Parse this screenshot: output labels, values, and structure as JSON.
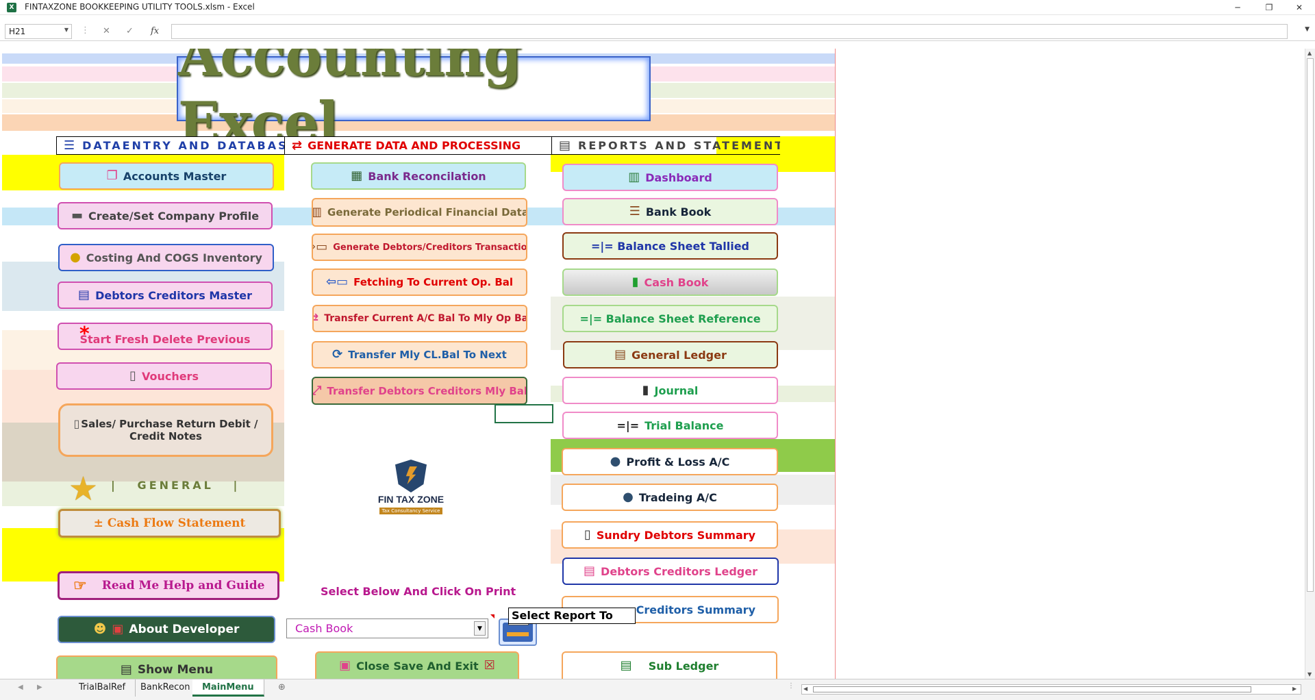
{
  "window": {
    "title": "FINTAXZONE BOOKKEEPING UTILITY TOOLS.xlsm - Excel",
    "app_icon": "excel-icon",
    "minimize": "─",
    "restore": "❐",
    "close": "✕"
  },
  "formula_bar": {
    "name_box": "H21",
    "cancel": "✕",
    "enter": "✓",
    "fx": "fx",
    "formula": ""
  },
  "banner": {
    "title": "Accounting Excel"
  },
  "sections": {
    "data_entry": "DATAENTRY AND DATABASE",
    "generate": "GENERATE DATA AND PROCESSING",
    "reports": "REPORTS AND STATEMENTS",
    "general": "|   GENERAL   |"
  },
  "left_buttons": {
    "accounts_master": "Accounts Master",
    "company_profile": "Create/Set Company Profile",
    "costing": "Costing And COGS Inventory",
    "debtors_creditors_master": "Debtors Creditors Master",
    "start_fresh": "Start Fresh Delete Previous",
    "vouchers": "Vouchers",
    "sales_purchase_line1": "Sales/ Purchase Return Debit /",
    "sales_purchase_line2": "Credit Notes",
    "cash_flow": "± Cash Flow Statement",
    "read_me": "Read Me Help and Guide",
    "about_developer": "About Developer",
    "show_menu": "Show Menu"
  },
  "mid_buttons": {
    "bank_reconcilation": "Bank Reconcilation",
    "periodical": "Generate Periodical Financial Data",
    "debtors_creditors_txn": "Generate Debtors/Creditors Transaction",
    "fetching": "Fetching  To Current Op. Bal",
    "transfer_current": "Transfer Current A/C Bal  To Mly Op Bal",
    "transfer_mly": "Transfer Mly  CL.Bal To Next",
    "transfer_debtors": "Transfer Debtors Creditors Mly Bal",
    "close_save": "Close Save And Exit"
  },
  "right_buttons": {
    "dashboard": "Dashboard",
    "bank_book": "Bank Book",
    "bs_tallied": "=|=   Balance Sheet Tallied",
    "cash_book": "Cash Book",
    "bs_reference": "=|=  Balance Sheet Reference",
    "general_ledger": "General Ledger",
    "journal": "Journal",
    "trial_balance_sym": "=|=",
    "trial_balance": "Trial Balance",
    "profit_loss": "Profit & Loss A/C",
    "trading": "Tradeing A/C",
    "sundry_debtors": "Sundry Debtors Summary",
    "debtors_creditors_ledger": "Debtors Creditors Ledger",
    "sundry_creditors": "ry Creditors Summary",
    "sub_ledger": "Sub Ledger"
  },
  "logo": {
    "name": "FIN TAX ZONE",
    "tagline": "Tax Consultancy Service"
  },
  "report_select": {
    "instruction": "Select Below And Click On Print",
    "selected": "Cash Book",
    "tooltip": "Select Report To"
  },
  "sheet_tabs": [
    "TrialBalRef",
    "BankRecon",
    "MainMenu"
  ],
  "active_tab": "MainMenu",
  "colors": {
    "excel_green": "#217346",
    "banner_text": "#6b7d3a",
    "highlight_yellow": "#ffff00",
    "highlight_green": "#92d050"
  }
}
